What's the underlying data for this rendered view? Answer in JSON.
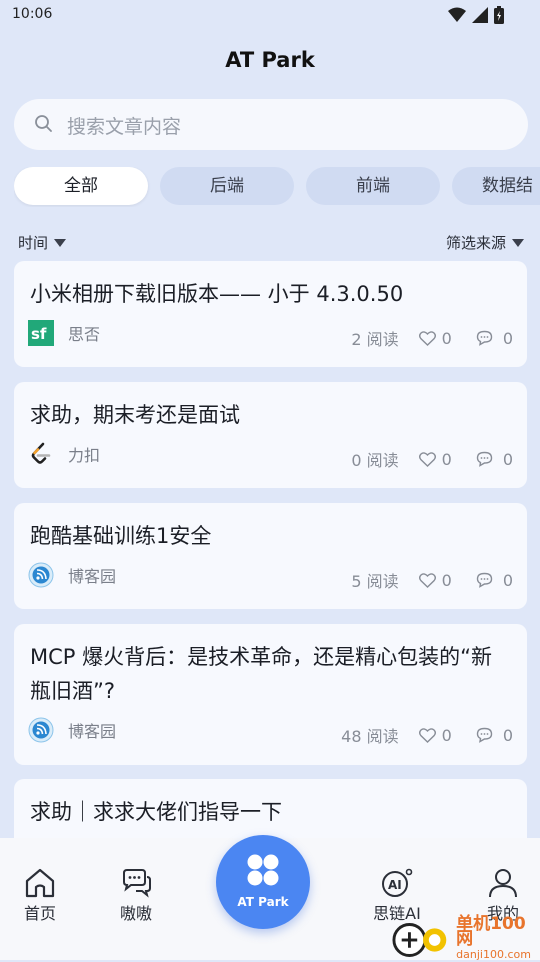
{
  "status": {
    "time": "10:06"
  },
  "app": {
    "title": "AT Park"
  },
  "search": {
    "placeholder": "搜索文章内容"
  },
  "categories": [
    "全部",
    "后端",
    "前端",
    "数据结"
  ],
  "filters": {
    "time": "时间",
    "source": "筛选来源"
  },
  "articles": [
    {
      "title": "小米相册下载旧版本—— 小于 4.3.0.50",
      "source": "思否",
      "reads": "2 阅读",
      "likes": "0",
      "comments": "0"
    },
    {
      "title": "求助，期末考还是面试",
      "source": "力扣",
      "reads": "0 阅读",
      "likes": "0",
      "comments": "0"
    },
    {
      "title": "跑酷基础训练1安全",
      "source": "博客园",
      "reads": "5 阅读",
      "likes": "0",
      "comments": "0"
    },
    {
      "title": "MCP 爆火背后：是技术革命，还是精心包装的“新瓶旧酒”?",
      "source": "博客园",
      "reads": "48 阅读",
      "likes": "0",
      "comments": "0"
    },
    {
      "title": "求助｜求求大佬们指导一下"
    }
  ],
  "tabs": {
    "home": "首页",
    "chat": "嗷嗷",
    "center": "AT Park",
    "ai": "思链AI",
    "me": "我的"
  },
  "watermark": {
    "name": "单机100网",
    "url": "danji100.com"
  },
  "colors": {
    "accent": "#4b86f2",
    "background": "#dfe7f8",
    "card": "#f7f9fe"
  }
}
